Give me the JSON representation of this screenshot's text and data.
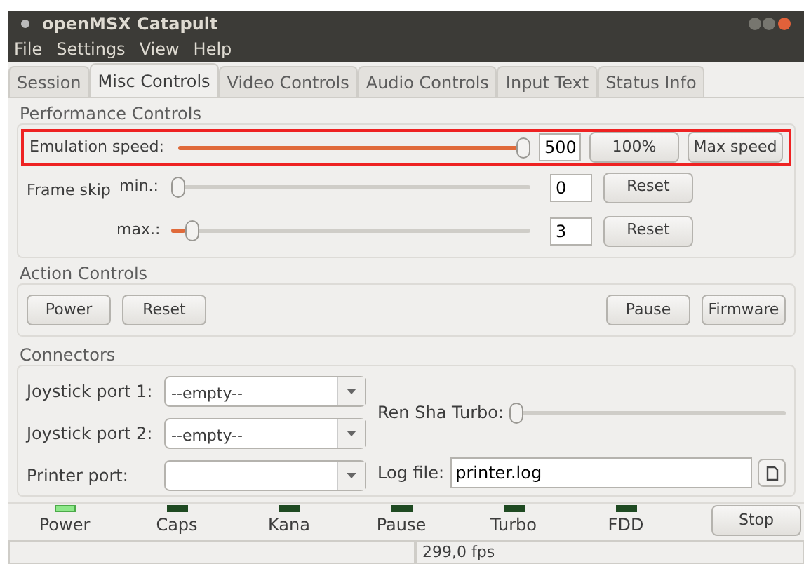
{
  "window": {
    "title": "openMSX Catapult"
  },
  "menu": [
    "File",
    "Settings",
    "View",
    "Help"
  ],
  "tabs": [
    {
      "label": "Session",
      "selected": false
    },
    {
      "label": "Misc Controls",
      "selected": true
    },
    {
      "label": "Video Controls",
      "selected": false
    },
    {
      "label": "Audio Controls",
      "selected": false
    },
    {
      "label": "Input Text",
      "selected": false
    },
    {
      "label": "Status Info",
      "selected": false
    }
  ],
  "performance": {
    "title": "Performance Controls",
    "emulation": {
      "label": "Emulation speed:",
      "level": 1.0,
      "value": "500",
      "buttons": [
        "100%",
        "Max speed"
      ]
    },
    "frame_skip": {
      "label": "Frame skip",
      "rows": [
        {
          "label": "min.:",
          "level": 0,
          "value": "0",
          "button": "Reset"
        },
        {
          "label": "max.:",
          "level": 0.04,
          "value": "3",
          "button": "Reset"
        }
      ]
    }
  },
  "actions": {
    "title": "Action Controls",
    "left": [
      "Power",
      "Reset"
    ],
    "right": [
      "Pause",
      "Firmware"
    ]
  },
  "connectors": {
    "title": "Connectors",
    "joystick1": {
      "label": "Joystick port 1:",
      "value": "--empty--"
    },
    "joystick2": {
      "label": "Joystick port 2:",
      "value": "--empty--"
    },
    "printer": {
      "label": "Printer port:"
    },
    "ren_sha": {
      "label": "Ren Sha Turbo:",
      "level": 0
    },
    "log_file": {
      "label": "Log file:",
      "value": "printer.log"
    }
  },
  "leds": [
    {
      "label": "Power",
      "on": true
    },
    {
      "label": "Caps",
      "on": false
    },
    {
      "label": "Kana",
      "on": false
    },
    {
      "label": "Pause",
      "on": false
    },
    {
      "label": "Turbo",
      "on": false
    },
    {
      "label": "FDD",
      "on": false
    }
  ],
  "stop_button": "Stop",
  "status_bar": {
    "fps": "299,0 fps"
  }
}
